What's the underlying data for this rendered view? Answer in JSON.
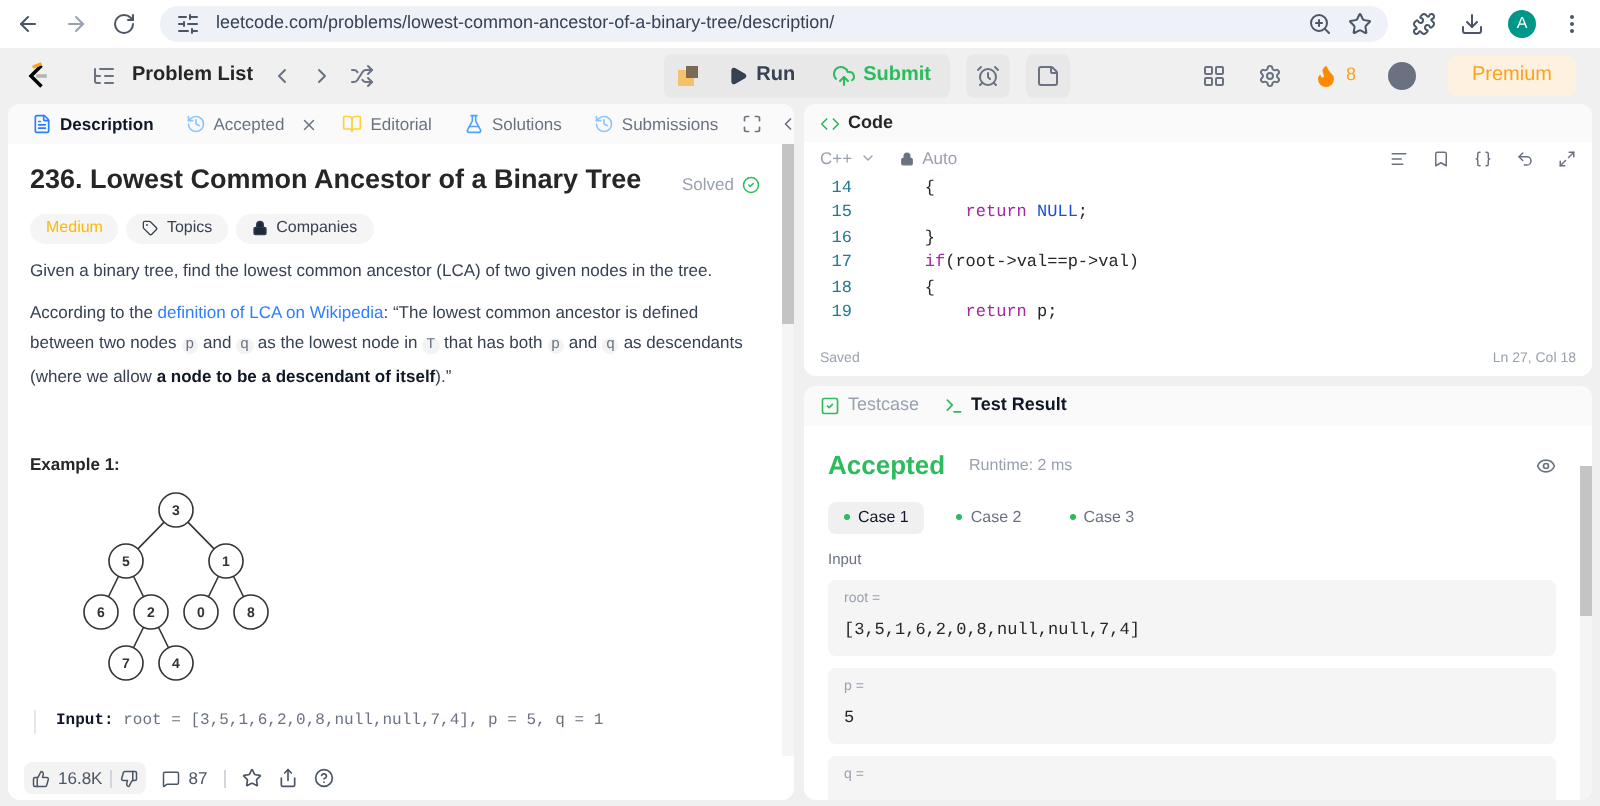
{
  "browser": {
    "url": "leetcode.com/problems/lowest-common-ancestor-of-a-binary-tree/description/",
    "profile": "A"
  },
  "nav": {
    "problem_list": "Problem List",
    "run": "Run",
    "submit": "Submit",
    "streak": "8",
    "premium": "Premium"
  },
  "left_tabs": [
    {
      "label": "Description",
      "selected": true,
      "closable": false
    },
    {
      "label": "Accepted",
      "selected": false,
      "closable": true
    },
    {
      "label": "Editorial",
      "selected": false,
      "closable": false
    },
    {
      "label": "Solutions",
      "selected": false,
      "closable": false
    },
    {
      "label": "Submissions",
      "selected": false,
      "closable": false
    }
  ],
  "problem": {
    "title": "236. Lowest Common Ancestor of a Binary Tree",
    "status": "Solved",
    "difficulty": "Medium",
    "tags": [
      {
        "label": "Topics",
        "kind": "tag"
      },
      {
        "label": "Companies",
        "kind": "lock"
      }
    ],
    "paragraphs": [
      [
        {
          "kind": "text",
          "text": "Given a binary tree, find the lowest common ancestor (LCA) of two given nodes in the tree."
        }
      ],
      [
        {
          "kind": "text",
          "text": "According to the "
        },
        {
          "kind": "link",
          "text": "definition of LCA on Wikipedia"
        },
        {
          "kind": "text",
          "text": ": “The lowest common ancestor is defined between two nodes "
        },
        {
          "kind": "code",
          "text": "p"
        },
        {
          "kind": "text",
          "text": " and "
        },
        {
          "kind": "code",
          "text": "q"
        },
        {
          "kind": "text",
          "text": " as the lowest node in "
        },
        {
          "kind": "code",
          "text": "T"
        },
        {
          "kind": "text",
          "text": " that has both "
        },
        {
          "kind": "code",
          "text": "p"
        },
        {
          "kind": "text",
          "text": " and "
        },
        {
          "kind": "code",
          "text": "q"
        },
        {
          "kind": "text",
          "text": " as descendants (where we allow "
        },
        {
          "kind": "bold",
          "text": "a node to be a descendant of itself"
        },
        {
          "kind": "text",
          "text": ").”"
        }
      ]
    ],
    "example_title": "Example 1:",
    "tree": {
      "value": "3",
      "children": [
        {
          "value": "5",
          "children": [
            {
              "value": "6"
            },
            {
              "value": "2",
              "children": [
                {
                  "value": "7"
                },
                {
                  "value": "4"
                }
              ]
            }
          ]
        },
        {
          "value": "1",
          "children": [
            {
              "value": "0"
            },
            {
              "value": "8"
            }
          ]
        }
      ]
    },
    "example_label": "Input:",
    "example_input": "root = [3,5,1,6,2,0,8,null,null,7,4], p = 5, q = 1"
  },
  "footer": {
    "likes": "16.8K",
    "comments": "87"
  },
  "code": {
    "tab": "Code",
    "language": "C++",
    "mode": "Auto",
    "lines": [
      {
        "number": "14",
        "tokens": [
          {
            "kind": "plain",
            "text": "    {"
          }
        ]
      },
      {
        "number": "15",
        "tokens": [
          {
            "kind": "keyword",
            "text": "        return "
          },
          {
            "kind": "constant",
            "text": "NULL"
          },
          {
            "kind": "plain",
            "text": ";"
          }
        ]
      },
      {
        "number": "16",
        "tokens": [
          {
            "kind": "plain",
            "text": "    }"
          }
        ]
      },
      {
        "number": "17",
        "tokens": [
          {
            "kind": "keyword",
            "text": "    if"
          },
          {
            "kind": "plain",
            "text": "(root->val==p->val)"
          }
        ]
      },
      {
        "number": "18",
        "tokens": [
          {
            "kind": "plain",
            "text": "    {"
          }
        ]
      },
      {
        "number": "19",
        "tokens": [
          {
            "kind": "keyword",
            "text": "        return "
          },
          {
            "kind": "plain",
            "text": "p;"
          }
        ]
      }
    ],
    "saved": "Saved",
    "cursor": "Ln 27, Col 18"
  },
  "test_tabs": [
    {
      "label": "Testcase",
      "selected": false
    },
    {
      "label": "Test Result",
      "selected": true
    }
  ],
  "result": {
    "status": "Accepted",
    "runtime": "Runtime: 2 ms",
    "cases": [
      {
        "label": "Case 1",
        "selected": true
      },
      {
        "label": "Case 2",
        "selected": false
      },
      {
        "label": "Case 3",
        "selected": false
      }
    ],
    "input_label": "Input",
    "inputs": [
      {
        "name": "root =",
        "value": "[3,5,1,6,2,0,8,null,null,7,4]"
      },
      {
        "name": "p =",
        "value": "5"
      },
      {
        "name": "q ="
      }
    ]
  }
}
